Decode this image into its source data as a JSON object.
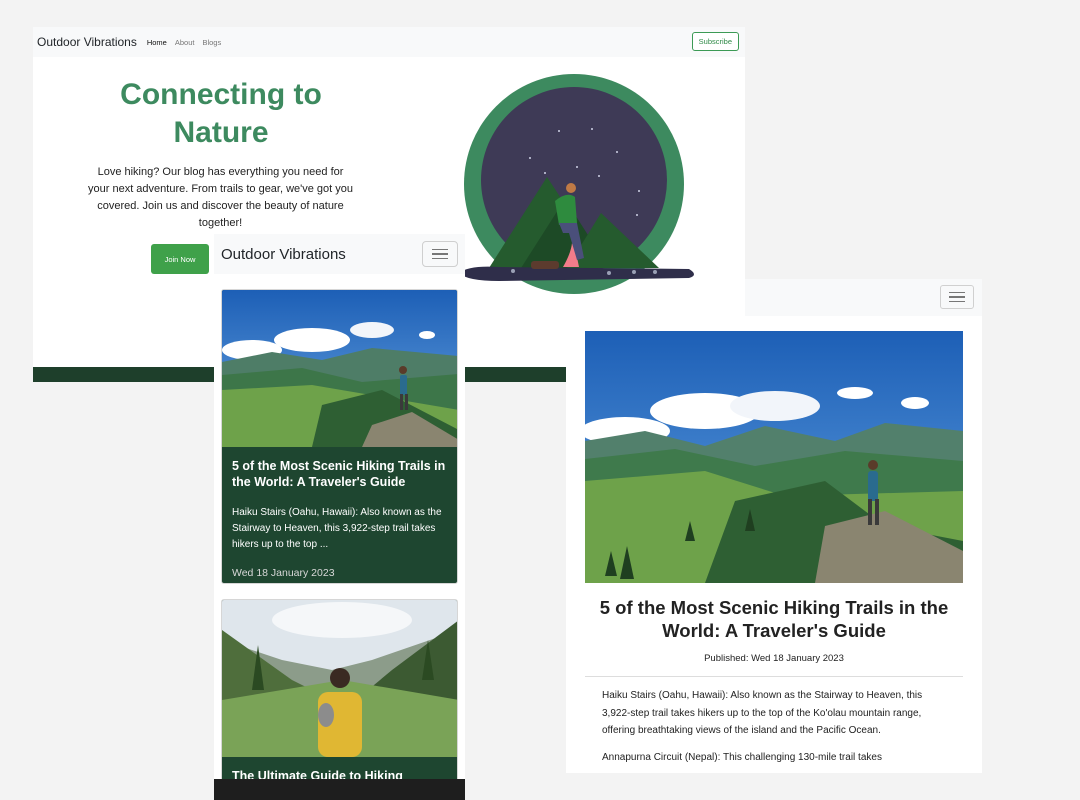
{
  "home": {
    "nav": {
      "brand": "Outdoor Vibrations",
      "links": [
        "Home",
        "About",
        "Blogs"
      ],
      "subscribe_label": "Subscribe"
    },
    "hero": {
      "title": "Connecting to Nature",
      "text": "Love hiking? Our blog has everything you need for your next adventure. From trails to gear, we've got you covered. Join us and discover the beauty of nature together!",
      "join_label": "Join Now"
    }
  },
  "mobile": {
    "brand": "Outdoor Vibrations",
    "cards": [
      {
        "title": "5 of the Most Scenic Hiking Trails in the World: A Traveler's Guide",
        "excerpt": "Haiku Stairs (Oahu, Hawaii): Also known as the Stairway to Heaven, this 3,922-step trail takes hikers up to the top ...",
        "date": "Wed 18 January 2023"
      },
      {
        "title": "The Ultimate Guide to Hiking Safety:"
      }
    ]
  },
  "post": {
    "title": "5 of the Most Scenic Hiking Trails in the World: A Traveler's Guide",
    "published": "Published: Wed 18 January 2023",
    "paragraphs": [
      "Haiku Stairs (Oahu, Hawaii): Also known as the Stairway to Heaven, this 3,922-step trail takes hikers up to the top of the Ko'olau mountain range, offering breathtaking views of the island and the Pacific Ocean.",
      "Annapurna Circuit (Nepal): This challenging 130-mile trail takes"
    ]
  },
  "colors": {
    "brand_green": "#3d8a5f",
    "card_green": "#1e4630",
    "button_green": "#3fa14a",
    "footer_dark": "#1e3f2b"
  }
}
